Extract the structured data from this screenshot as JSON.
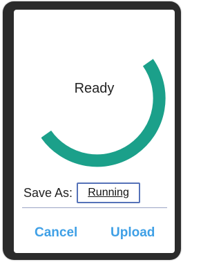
{
  "dialog": {
    "status_text": "Ready",
    "accent_color": "#1ba08a",
    "save_as_label": "Save As:",
    "filename_value": "Running",
    "cancel_label": "Cancel",
    "upload_label": "Upload",
    "button_color": "#3fa0e6"
  }
}
